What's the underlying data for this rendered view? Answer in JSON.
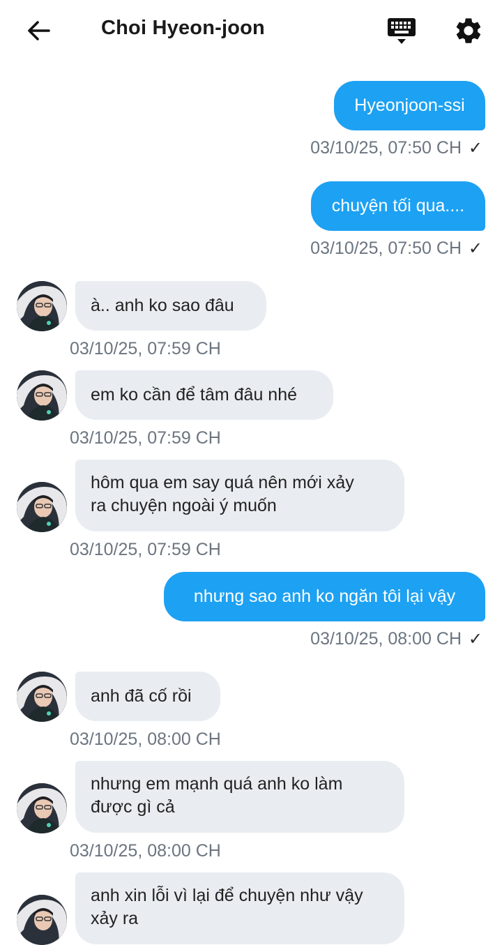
{
  "header": {
    "title": "Choi Hyeon-joon",
    "icons": [
      "back-arrow-icon",
      "keyboard-icon",
      "settings-gear-icon"
    ]
  },
  "messages": [
    {
      "side": "out",
      "text": "Hyeonjoon-ssi",
      "time": "03/10/25, 07:50 CH",
      "status": "✓"
    },
    {
      "side": "out",
      "text": "chuyện tối qua....",
      "time": "03/10/25, 07:50 CH",
      "status": "✓"
    },
    {
      "side": "in",
      "text": "à.. anh ko sao đâu",
      "time": "03/10/25, 07:59 CH"
    },
    {
      "side": "in",
      "text": "em ko cần để tâm đâu nhé",
      "time": "03/10/25, 07:59 CH"
    },
    {
      "side": "in",
      "lines": [
        "hôm qua em say quá nên mới xảy",
        "ra chuyện ngoài ý muốn"
      ],
      "time": "03/10/25, 07:59 CH"
    },
    {
      "side": "out",
      "text": "nhưng sao anh ko ngăn tôi lại vậy",
      "time": "03/10/25, 08:00 CH",
      "status": "✓"
    },
    {
      "side": "in",
      "text": "anh đã cố rồi",
      "time": "03/10/25, 08:00 CH"
    },
    {
      "side": "in",
      "lines": [
        "nhưng em mạnh quá anh ko làm",
        "được gì cả"
      ],
      "time": "03/10/25, 08:00 CH"
    },
    {
      "side": "in",
      "lines": [
        "anh xin lỗi vì lại để chuyện như vậy",
        "xảy ra"
      ]
    }
  ],
  "colors": {
    "outgoing": "#1da1f2",
    "incoming": "#e9edf1",
    "timestamp": "#6b7580"
  }
}
